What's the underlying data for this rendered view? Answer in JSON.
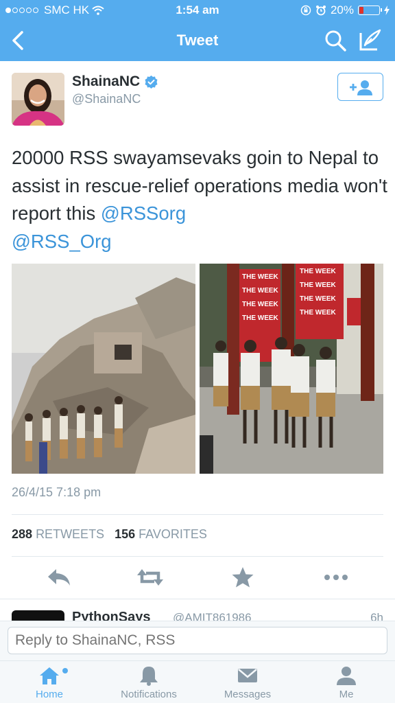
{
  "status_bar": {
    "carrier": "SMC HK",
    "time": "1:54 am",
    "battery": "20%",
    "signal_bars_filled": 1,
    "signal_bars_total": 5
  },
  "nav": {
    "title": "Tweet",
    "icons": [
      "chevron-left-icon",
      "search-icon",
      "compose-icon"
    ]
  },
  "tweet": {
    "author_name": "ShainaNC",
    "author_handle": "@ShainaNC",
    "text_plain": "20000 RSS swayamsevaks goin to Nepal to assist in rescue-relief operations media won't report this ",
    "mention1": "@RSSorg",
    "mention2": "@RSS_Org",
    "timestamp": "26/4/15 7:18 pm",
    "retweets_count": "288",
    "retweets_label": "RETWEETS",
    "favorites_count": "156",
    "favorites_label": "FAVORITES",
    "photo2_banner": "THE WEEK"
  },
  "actions": [
    "reply-icon",
    "retweet-icon",
    "favorite-icon",
    "more-icon"
  ],
  "next_tweet": {
    "name": "PythonSays",
    "handle": "@AMIT861986",
    "time": "6h"
  },
  "reply": {
    "placeholder": "Reply to ShainaNC, RSS"
  },
  "tabs": [
    {
      "label": "Home",
      "icon": "home-icon"
    },
    {
      "label": "Notifications",
      "icon": "bell-icon"
    },
    {
      "label": "Messages",
      "icon": "envelope-icon"
    },
    {
      "label": "Me",
      "icon": "person-icon"
    }
  ],
  "colors": {
    "brand": "#55acee",
    "link": "#3b94d9",
    "text": "#292f33",
    "muted": "#8899a6",
    "battery_low": "#e0332b"
  }
}
